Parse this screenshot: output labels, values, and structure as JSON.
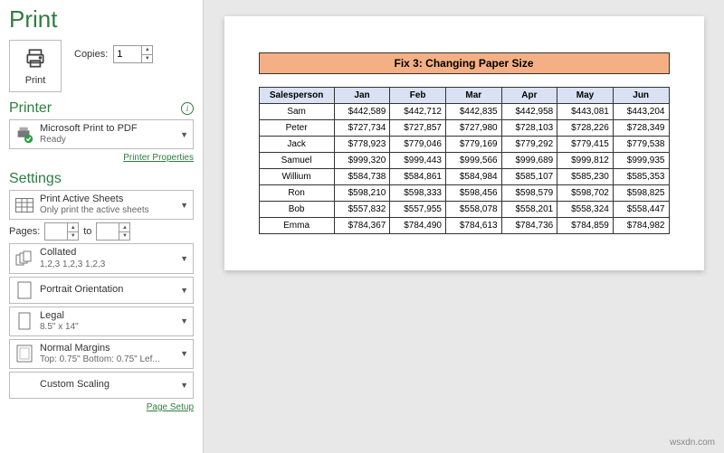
{
  "header": {
    "title": "Print"
  },
  "print": {
    "button": "Print",
    "copies_label": "Copies:",
    "copies_value": "1"
  },
  "printer": {
    "section": "Printer",
    "name": "Microsoft Print to PDF",
    "status": "Ready",
    "link": "Printer Properties"
  },
  "settings": {
    "section": "Settings",
    "sheets": {
      "main": "Print Active Sheets",
      "sub": "Only print the active sheets"
    },
    "pages": {
      "label": "Pages:",
      "to": "to",
      "from": "",
      "to_val": ""
    },
    "collated": {
      "main": "Collated",
      "sub": "1,2,3   1,2,3   1,2,3"
    },
    "orientation": {
      "main": "Portrait Orientation"
    },
    "paper": {
      "main": "Legal",
      "sub": "8.5\" x 14\""
    },
    "margins": {
      "main": "Normal Margins",
      "sub": "Top: 0.75\" Bottom: 0.75\" Lef..."
    },
    "scaling": {
      "main": "Custom Scaling"
    },
    "link": "Page Setup"
  },
  "preview": {
    "title": "Fix 3: Changing Paper Size",
    "headers": [
      "Salesperson",
      "Jan",
      "Feb",
      "Mar",
      "Apr",
      "May",
      "Jun"
    ],
    "rows": [
      [
        "Sam",
        "$442,589",
        "$442,712",
        "$442,835",
        "$442,958",
        "$443,081",
        "$443,204"
      ],
      [
        "Peter",
        "$727,734",
        "$727,857",
        "$727,980",
        "$728,103",
        "$728,226",
        "$728,349"
      ],
      [
        "Jack",
        "$778,923",
        "$779,046",
        "$779,169",
        "$779,292",
        "$779,415",
        "$779,538"
      ],
      [
        "Samuel",
        "$999,320",
        "$999,443",
        "$999,566",
        "$999,689",
        "$999,812",
        "$999,935"
      ],
      [
        "Willium",
        "$584,738",
        "$584,861",
        "$584,984",
        "$585,107",
        "$585,230",
        "$585,353"
      ],
      [
        "Ron",
        "$598,210",
        "$598,333",
        "$598,456",
        "$598,579",
        "$598,702",
        "$598,825"
      ],
      [
        "Bob",
        "$557,832",
        "$557,955",
        "$558,078",
        "$558,201",
        "$558,324",
        "$558,447"
      ],
      [
        "Emma",
        "$784,367",
        "$784,490",
        "$784,613",
        "$784,736",
        "$784,859",
        "$784,982"
      ]
    ]
  },
  "watermark": "wsxdn.com"
}
